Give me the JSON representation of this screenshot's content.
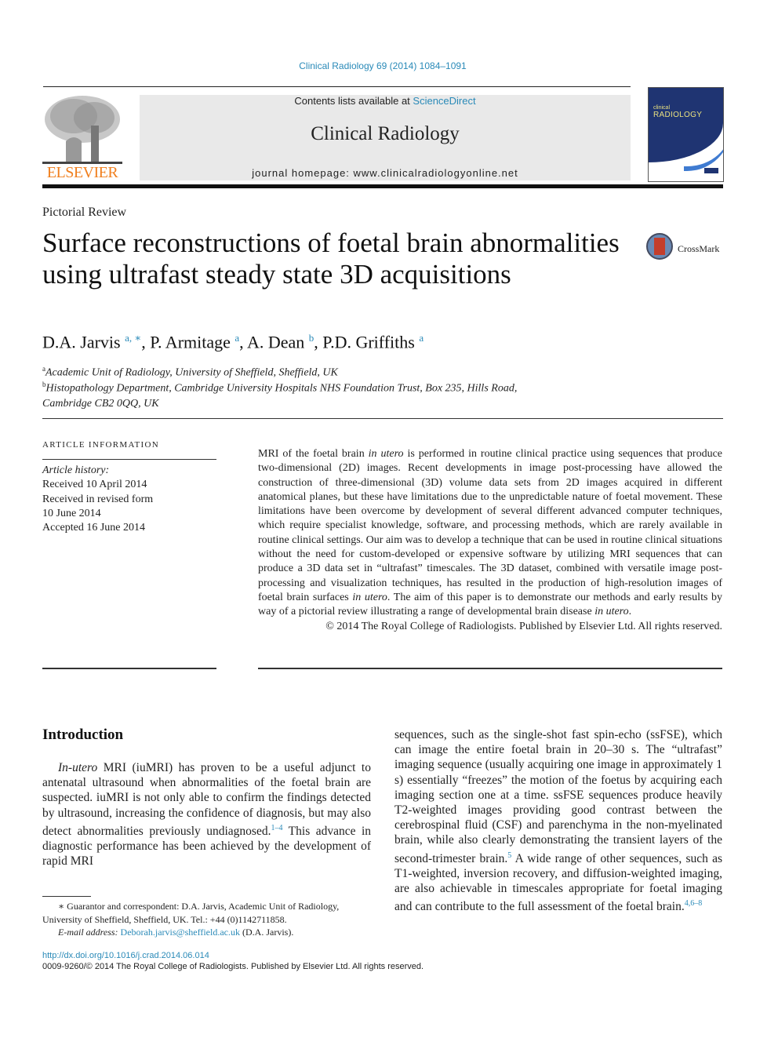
{
  "header": {
    "journal_reference": "Clinical Radiology 69 (2014) 1084–1091",
    "contents_prefix": "Contents lists available at ",
    "contents_link": "ScienceDirect",
    "journal_title": "Clinical Radiology",
    "homepage_label": "journal homepage: www.clinicalradiologyonline.net",
    "publisher_logo": "ELSEVIER",
    "cover_title_small": "clinical",
    "cover_title_big": "RADIOLOGY",
    "colors": {
      "link": "#2a8ab8",
      "elsevier_orange": "#f07f1e",
      "cover_blue": "#1f3472"
    }
  },
  "article": {
    "type": "Pictorial Review",
    "title": "Surface reconstructions of foetal brain abnormalities using ultrafast steady state 3D acquisitions",
    "crossmark_label": "CrossMark",
    "authors": [
      {
        "name": "D.A. Jarvis",
        "affil": "a, ∗",
        "sep": ", "
      },
      {
        "name": "P. Armitage",
        "affil": "a",
        "sep": ", "
      },
      {
        "name": "A. Dean",
        "affil": "b",
        "sep": ", "
      },
      {
        "name": "P.D. Griffiths",
        "affil": "a",
        "sep": ""
      }
    ],
    "affiliations": [
      {
        "key": "a",
        "text": "Academic Unit of Radiology, University of Sheffield, Sheffield, UK"
      },
      {
        "key": "b",
        "text": "Histopathology Department, Cambridge University Hospitals NHS Foundation Trust, Box 235, Hills Road,",
        "text2": "Cambridge CB2 0QQ, UK"
      }
    ]
  },
  "article_info": {
    "heading": "ARTICLE INFORMATION",
    "history_label": "Article history:",
    "history": [
      "Received 10 April 2014",
      "Received in revised form",
      "10 June 2014",
      "Accepted 16 June 2014"
    ]
  },
  "abstract": {
    "p1": "MRI of the foetal brain ",
    "i1": "in utero",
    "p2": " is performed in routine clinical practice using sequences that produce two-dimensional (2D) images. Recent developments in image post-processing have allowed the construction of three-dimensional (3D) volume data sets from 2D images acquired in different anatomical planes, but these have limitations due to the unpredictable nature of foetal movement. These limitations have been overcome by development of several different advanced computer techniques, which require specialist knowledge, software, and processing methods, which are rarely available in routine clinical settings. Our aim was to develop a technique that can be used in routine clinical situations without the need for custom-developed or expensive software by utilizing MRI sequences that can produce a 3D data set in “ultrafast” timescales. The 3D dataset, combined with versatile image post-processing and visualization techniques, has resulted in the production of high-resolution images of foetal brain surfaces ",
    "i2": "in utero",
    "p3": ". The aim of this paper is to demonstrate our methods and early results by way of a pictorial review illustrating a range of developmental brain disease ",
    "i3": "in utero",
    "p4": ".",
    "copyright": "© 2014 The Royal College of Radiologists. Published by Elsevier Ltd. All rights reserved."
  },
  "introduction": {
    "heading": "Introduction",
    "left": {
      "i1": "In-utero",
      "t1": " MRI (iuMRI) has proven to be a useful adjunct to antenatal ultrasound when abnormalities of the foetal brain are suspected. iuMRI is not only able to confirm the findings detected by ultrasound, increasing the confidence of diagnosis, but may also detect abnormalities previously undiagnosed.",
      "ref1": "1–4",
      "t2": " This advance in diagnostic performance has been achieved by the development of rapid MRI"
    },
    "right": {
      "t1": "sequences, such as the single-shot fast spin-echo (ssFSE), which can image the entire foetal brain in 20–30 s. The “ultrafast” imaging sequence (usually acquiring one image in approximately 1 s) essentially “freezes” the motion of the foetus by acquiring each imaging section one at a time. ssFSE sequences produce heavily T2-weighted images providing good contrast between the cerebrospinal fluid (CSF) and parenchyma in the non-myelinated brain, while also clearly demonstrating the transient layers of the second-trimester brain.",
      "ref1": "5",
      "t2": " A wide range of other sequences, such as T1-weighted, inversion recovery, and diffusion-weighted imaging, are also achievable in timescales appropriate for foetal imaging and can contribute to the full assessment of the foetal brain.",
      "ref2": "4,6–8"
    }
  },
  "footnote": {
    "star_text": "∗ Guarantor and correspondent: D.A. Jarvis, Academic Unit of Radiology, University of Sheffield, Sheffield, UK. Tel.: +44 (0)1142711858.",
    "email_label": "E-mail address: ",
    "email": "Deborah.jarvis@sheffield.ac.uk",
    "email_suffix": " (D.A. Jarvis)."
  },
  "footer": {
    "doi": "http://dx.doi.org/10.1016/j.crad.2014.06.014",
    "issn_line": "0009-9260/© 2014 The Royal College of Radiologists. Published by Elsevier Ltd. All rights reserved."
  }
}
